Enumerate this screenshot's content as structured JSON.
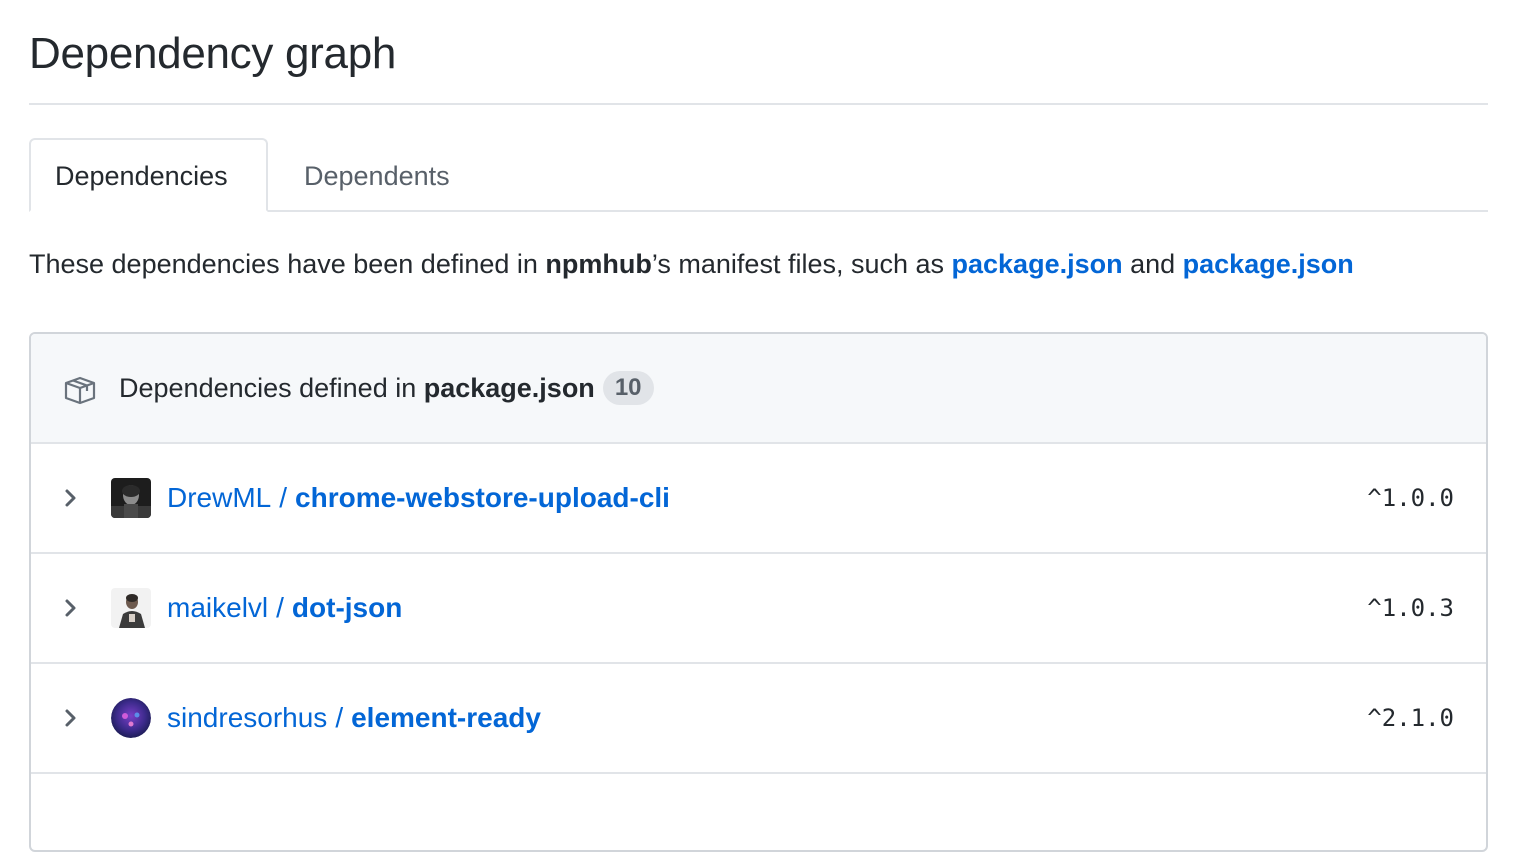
{
  "page": {
    "title": "Dependency graph"
  },
  "tabs": [
    {
      "label": "Dependencies",
      "selected": true
    },
    {
      "label": "Dependents",
      "selected": false
    }
  ],
  "intro": {
    "prefix": "These dependencies have been defined in ",
    "repo": "npmhub",
    "middle": "’s manifest files, such as ",
    "link1": "package.json",
    "conjunction": " and ",
    "link2": "package.json"
  },
  "box": {
    "header_prefix": "Dependencies defined in ",
    "header_file": "package.json",
    "count": "10",
    "icon": "package-icon"
  },
  "dependencies": [
    {
      "owner": "DrewML",
      "separator": "/",
      "repo": "chrome-webstore-upload-cli",
      "version": "^1.0.0",
      "icon": "chevron-right-icon"
    },
    {
      "owner": "maikelvl",
      "separator": "/",
      "repo": "dot-json",
      "version": "^1.0.3",
      "icon": "chevron-right-icon"
    },
    {
      "owner": "sindresorhus",
      "separator": "/",
      "repo": "element-ready",
      "version": "^2.1.0",
      "icon": "chevron-right-icon"
    }
  ],
  "colors": {
    "link": "#0366d6",
    "text": "#24292e",
    "muted": "#586069",
    "border": "#e1e4e8",
    "header_bg": "#f6f8fa"
  }
}
